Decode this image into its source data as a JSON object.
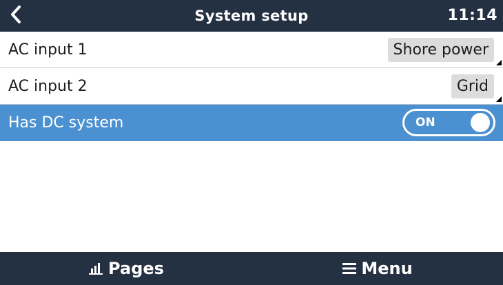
{
  "header": {
    "back_icon": "chevron-left-icon",
    "title": "System setup",
    "time": "11:14"
  },
  "rows": [
    {
      "label": "AC input 1",
      "value": "Shore power"
    },
    {
      "label": "AC input 2",
      "value": "Grid"
    },
    {
      "label": "Has DC system",
      "toggle": "ON",
      "toggle_state": true,
      "selected": true
    }
  ],
  "footer": {
    "pages_label": "Pages",
    "pages_icon": "bar-chart-icon",
    "menu_label": "Menu",
    "menu_icon": "hamburger-menu-icon"
  },
  "colors": {
    "header_bg": "#243142",
    "selected_bg": "#4b90d0",
    "value_box_bg": "#dcdcdc"
  }
}
